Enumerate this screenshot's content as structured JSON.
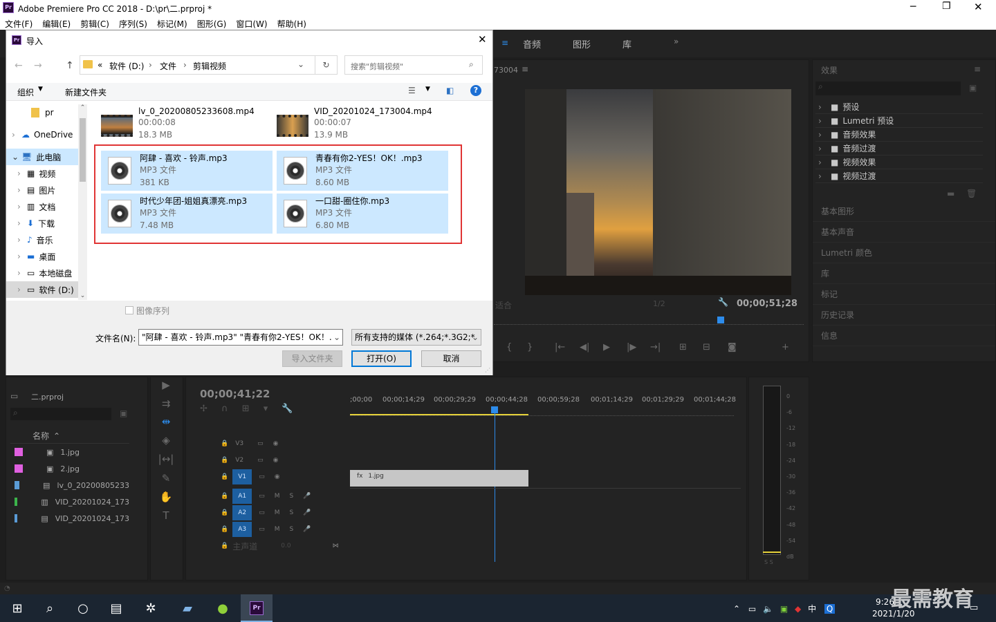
{
  "window": {
    "title": "Adobe Premiere Pro CC 2018 - D:\\pr\\二.prproj *"
  },
  "menu": [
    "文件(F)",
    "编辑(E)",
    "剪辑(C)",
    "序列(S)",
    "标记(M)",
    "图形(G)",
    "窗口(W)",
    "帮助(H)"
  ],
  "workspace_tabs": [
    "音频",
    "图形",
    "库"
  ],
  "program": {
    "clip_partial": "73004",
    "fit": "适合",
    "res": "1/2",
    "timecode": "00;00;51;28"
  },
  "effects": {
    "title": "效果",
    "items": [
      "预设",
      "Lumetri 预设",
      "音频效果",
      "音频过渡",
      "视频效果",
      "视频过渡"
    ],
    "sections": [
      "基本图形",
      "基本声音",
      "Lumetri 颜色",
      "库",
      "标记",
      "历史记录",
      "信息"
    ]
  },
  "dialog": {
    "title": "导入",
    "breadcrumb": [
      "软件 (D:)",
      "文件",
      "剪辑视频"
    ],
    "breadcrumb_prefix": "«",
    "search_placeholder": "搜索\"剪辑视频\"",
    "organize": "组织",
    "new_folder": "新建文件夹",
    "nav": [
      {
        "label": "pr",
        "icon": "folder-icon"
      },
      {
        "label": "OneDrive",
        "icon": "cloud-icon"
      },
      {
        "label": "此电脑",
        "icon": "computer-icon"
      },
      {
        "label": "视频",
        "icon": "video-folder-icon"
      },
      {
        "label": "图片",
        "icon": "picture-folder-icon"
      },
      {
        "label": "文档",
        "icon": "document-folder-icon"
      },
      {
        "label": "下载",
        "icon": "download-icon"
      },
      {
        "label": "音乐",
        "icon": "music-icon"
      },
      {
        "label": "桌面",
        "icon": "desktop-icon"
      },
      {
        "label": "本地磁盘",
        "icon": "drive-icon"
      },
      {
        "label": "软件 (D:)",
        "icon": "drive-icon"
      }
    ],
    "files": [
      {
        "name": "lv_0_20200805233608.mp4",
        "type": "00:00:08",
        "size": "18.3 MB"
      },
      {
        "name": "VID_20201024_173004.mp4",
        "type": "00:00:07",
        "size": "13.9 MB"
      },
      {
        "name": "阿肆 - 喜欢 - 铃声.mp3",
        "type": "MP3 文件",
        "size": "381 KB"
      },
      {
        "name": "青春有你2-YES！OK！.mp3",
        "type": "MP3 文件",
        "size": "8.60 MB"
      },
      {
        "name": "时代少年团-姐姐真漂亮.mp3",
        "type": "MP3 文件",
        "size": "7.48 MB"
      },
      {
        "name": "一口甜-圈住你.mp3",
        "type": "MP3 文件",
        "size": "6.80 MB"
      }
    ],
    "image_sequence": "图像序列",
    "filename_label": "文件名(N):",
    "filename_value": "\"阿肆 - 喜欢 - 铃声.mp3\" \"青春有你2-YES！OK！.",
    "filetype_value": "所有支持的媒体 (*.264;*.3G2;*",
    "import_folder": "导入文件夹",
    "open": "打开(O)",
    "cancel": "取消"
  },
  "project": {
    "name": "二.prproj",
    "column": "名称",
    "items": [
      {
        "name": "1.jpg",
        "color": "#e060e0"
      },
      {
        "name": "2.jpg",
        "color": "#e060e0"
      },
      {
        "name": "lv_0_20200805233",
        "color": "#5a9bd6"
      },
      {
        "name": "VID_20201024_173",
        "color": "#3cb44b"
      },
      {
        "name": "VID_20201024_173",
        "color": "#5a9bd6"
      }
    ]
  },
  "timeline": {
    "timecode": "00;00;41;22",
    "ruler": [
      ";00;00",
      "00;00;14;29",
      "00;00;29;29",
      "00;00;44;28",
      "00;00;59;28",
      "00;01;14;29",
      "00;01;29;29",
      "00;01;44;28"
    ],
    "tracks": [
      "V3",
      "V2",
      "V1",
      "A1",
      "A2",
      "A3"
    ],
    "master": "主声道",
    "master_val": "0.0",
    "clip": "1.jpg"
  },
  "meter": {
    "ticks": [
      "0",
      "-6",
      "-12",
      "-18",
      "-24",
      "-30",
      "-36",
      "-42",
      "-48",
      "-54",
      "dB"
    ]
  },
  "taskbar": {
    "time": "9:26",
    "date": "2021/1/20",
    "ime": "中"
  },
  "watermark": "最需教育"
}
